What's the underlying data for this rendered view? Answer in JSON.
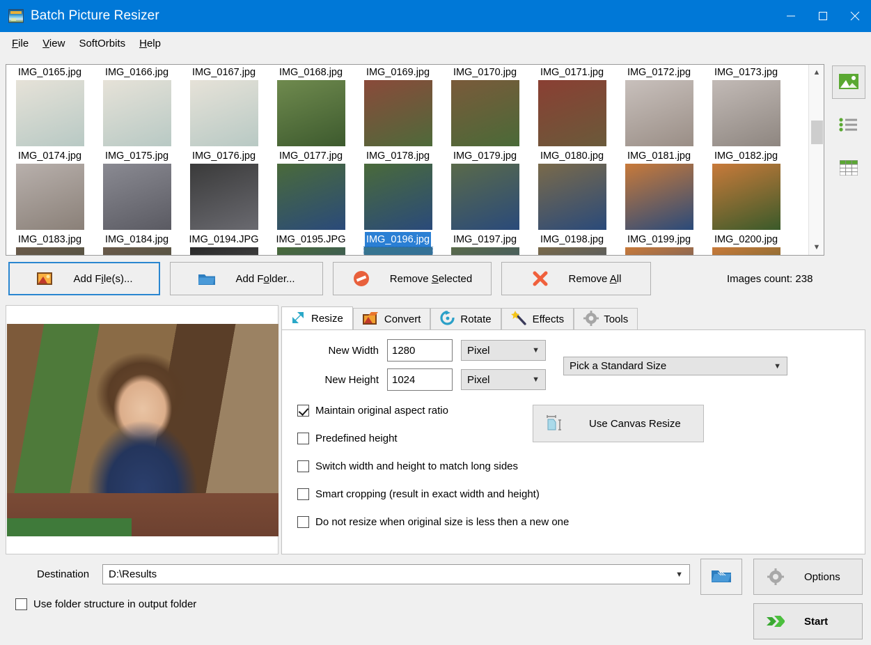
{
  "window": {
    "title": "Batch Picture Resizer",
    "icon": "app-icon",
    "controls": {
      "minimize": "minimize-icon",
      "maximize": "maximize-icon",
      "close": "close-icon"
    },
    "accent": "#0078d7"
  },
  "menu": {
    "items": [
      {
        "label": "File",
        "accel": "F"
      },
      {
        "label": "View",
        "accel": "V"
      },
      {
        "label": "SoftOrbits",
        "accel": ""
      },
      {
        "label": "Help",
        "accel": "H"
      }
    ]
  },
  "thumbnails": {
    "rows": [
      {
        "labels": [
          "IMG_0165.jpg",
          "IMG_0166.jpg",
          "IMG_0167.jpg",
          "IMG_0168.jpg",
          "IMG_0169.jpg",
          "IMG_0170.jpg",
          "IMG_0171.jpg",
          "IMG_0172.jpg",
          "IMG_0173.jpg"
        ]
      },
      {
        "labels": [
          "IMG_0174.jpg",
          "IMG_0175.jpg",
          "IMG_0176.jpg",
          "IMG_0177.jpg",
          "IMG_0178.jpg",
          "IMG_0179.jpg",
          "IMG_0180.jpg",
          "IMG_0181.jpg",
          "IMG_0182.jpg"
        ]
      },
      {
        "labels": [
          "IMG_0183.jpg",
          "IMG_0184.jpg",
          "IMG_0194.JPG",
          "IMG_0195.JPG",
          "IMG_0196.jpg",
          "IMG_0197.jpg",
          "IMG_0198.jpg",
          "IMG_0199.jpg",
          "IMG_0200.jpg"
        ]
      }
    ],
    "selected": "IMG_0196.jpg",
    "selection_color": "#2a7fd4"
  },
  "view_modes": [
    {
      "name": "thumbnail-view",
      "icon": "image-icon",
      "active": true
    },
    {
      "name": "list-view",
      "icon": "list-icon",
      "active": false
    },
    {
      "name": "details-view",
      "icon": "table-icon",
      "active": false
    }
  ],
  "actions": {
    "add_files": {
      "label": "Add File(s)...",
      "accel": "i",
      "icon": "picture-icon",
      "focused": true
    },
    "add_folder": {
      "label": "Add Folder...",
      "accel": "o",
      "icon": "folder-icon"
    },
    "remove_selected": {
      "label": "Remove Selected",
      "accel": "S",
      "icon": "no-entry-icon"
    },
    "remove_all": {
      "label": "Remove All",
      "accel": "A",
      "icon": "red-x-icon"
    },
    "images_count": "Images count: 238"
  },
  "tabs": [
    {
      "label": "Resize",
      "icon": "resize-arrows-icon",
      "active": true
    },
    {
      "label": "Convert",
      "icon": "convert-picture-icon",
      "active": false
    },
    {
      "label": "Rotate",
      "icon": "rotate-icon",
      "active": false
    },
    {
      "label": "Effects",
      "icon": "magic-wand-icon",
      "active": false
    },
    {
      "label": "Tools",
      "icon": "gear-icon",
      "active": false
    }
  ],
  "resize": {
    "width_label": "New Width",
    "width_value": "1280",
    "width_unit": "Pixel",
    "height_label": "New Height",
    "height_value": "1024",
    "height_unit": "Pixel",
    "standard_size": "Pick a Standard Size",
    "canvas_button": "Use Canvas Resize",
    "checkboxes": [
      {
        "label": "Maintain original aspect ratio",
        "checked": true
      },
      {
        "label": "Predefined height",
        "checked": false
      },
      {
        "label": "Switch width and height to match long sides",
        "checked": false
      },
      {
        "label": "Smart cropping (result in exact width and height)",
        "checked": false
      },
      {
        "label": "Do not resize when original size is less then a new one",
        "checked": false
      }
    ]
  },
  "footer": {
    "destination_label": "Destination",
    "destination_value": "D:\\Results",
    "browse_icon": "open-folder-icon",
    "use_folder_structure": {
      "label": "Use folder structure in output folder",
      "checked": false
    },
    "options_button": "Options",
    "options_icon": "gear-icon",
    "start_button": "Start",
    "start_icon": "green-arrow-icon"
  }
}
